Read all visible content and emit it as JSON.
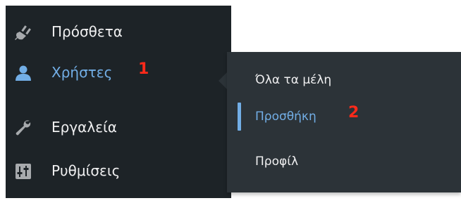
{
  "sidebar": {
    "items": [
      {
        "label": "Πρόσθετα",
        "icon": "plugin-icon"
      },
      {
        "label": "Χρήστες",
        "icon": "user-icon",
        "marker": "1",
        "current": true
      },
      {
        "label": "Εργαλεία",
        "icon": "wrench-icon"
      },
      {
        "label": "Ρυθμίσεις",
        "icon": "settings-icon"
      }
    ]
  },
  "submenu": {
    "items": [
      {
        "label": "Όλα τα μέλη"
      },
      {
        "label": "Προσθήκη",
        "marker": "2",
        "current": true
      },
      {
        "label": "Προφίλ"
      }
    ]
  },
  "colors": {
    "sidebar_bg": "#1d2327",
    "submenu_bg": "#2c3338",
    "text": "#f0f0f1",
    "accent": "#72aee6",
    "marker": "#ff2a1a"
  }
}
